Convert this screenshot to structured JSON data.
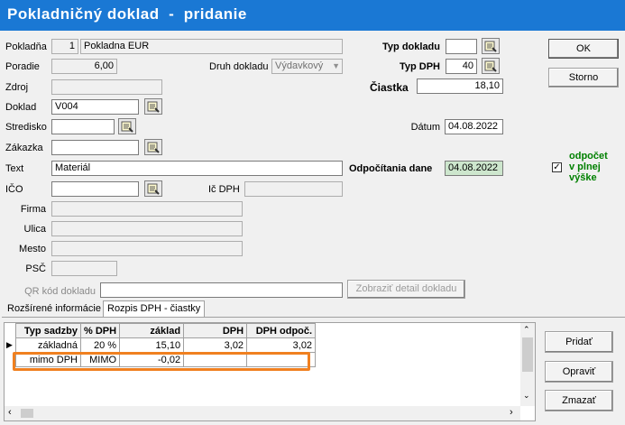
{
  "window": {
    "title": "Pokladničný doklad  -  pridanie"
  },
  "form": {
    "pokladna": {
      "label": "Pokladňa",
      "number": "1",
      "name": "Pokladna EUR"
    },
    "poradie": {
      "label": "Poradie",
      "value": "6,00"
    },
    "druh_dokladu": {
      "label": "Druh dokladu",
      "value": "Výdavkový"
    },
    "zdroj": {
      "label": "Zdroj",
      "value": ""
    },
    "doklad": {
      "label": "Doklad",
      "value": "V004"
    },
    "stredisko": {
      "label": "Stredisko",
      "value": ""
    },
    "zakazka": {
      "label": "Zákazka",
      "value": ""
    },
    "text": {
      "label": "Text",
      "value": "Materiál"
    },
    "ico": {
      "label": "IČO",
      "value": ""
    },
    "ic_dph": {
      "label": "Ič DPH",
      "value": ""
    },
    "firma": {
      "label": "Firma",
      "value": ""
    },
    "ulica": {
      "label": "Ulica",
      "value": ""
    },
    "mesto": {
      "label": "Mesto",
      "value": ""
    },
    "psc": {
      "label": "PSČ",
      "value": ""
    },
    "qr": {
      "label": "QR kód dokladu",
      "value": "",
      "detail_button": "Zobraziť detail dokladu"
    },
    "typ_dokladu": {
      "label": "Typ dokladu",
      "value": ""
    },
    "typ_dph": {
      "label": "Typ DPH",
      "value": "40"
    },
    "ciastka": {
      "label": "Čiastka",
      "value": "18,10"
    },
    "datum": {
      "label": "Dátum",
      "value": "04.08.2022"
    },
    "odpocitania_dane": {
      "label": "Odpočítania dane",
      "value": "04.08.2022"
    },
    "odpocet": {
      "label_line1": "odpočet",
      "label_line2": "v plnej",
      "label_line3": "výške",
      "checked": true,
      "color": "#008000"
    }
  },
  "buttons": {
    "ok": "OK",
    "storno": "Storno",
    "pridat": "Pridať",
    "opravit": "Opraviť",
    "zmazat": "Zmazať"
  },
  "tabs": [
    {
      "label": "Rozšírené informácie"
    },
    {
      "label": "Rozpis DPH - čiastky"
    }
  ],
  "grid": {
    "columns": [
      "Typ sadzby",
      "% DPH",
      "základ",
      "DPH",
      "DPH odpoč."
    ],
    "rows": [
      [
        "základná",
        "20 %",
        "15,10",
        "3,02",
        "3,02"
      ],
      [
        "mimo DPH",
        "MIMO",
        "-0,02",
        "",
        ""
      ]
    ],
    "highlight_color": "#f08020"
  },
  "colors": {
    "title_bar": "#1a78d4"
  }
}
